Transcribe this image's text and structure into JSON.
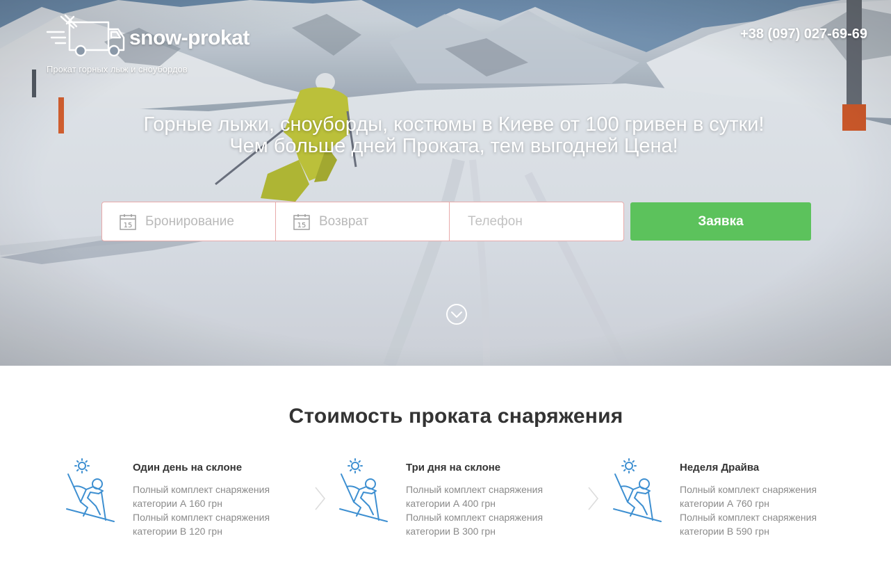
{
  "brand": {
    "name": "snow-prokat",
    "tagline": "Прокат горных лыж и сноубордов"
  },
  "header": {
    "phone": "+38 (097) 027-69-69"
  },
  "hero": {
    "headline_line1": "Горные лыжи, сноуборды, костюмы в Киеве от 100 гривен в сутки!",
    "headline_line2": "Чем больше дней Проката, тем выгодней Цена!"
  },
  "booking_form": {
    "booking_date": {
      "placeholder": "Бронирование",
      "value": "",
      "icon": "calendar-icon",
      "calendar_day": "15"
    },
    "return_date": {
      "placeholder": "Возврат",
      "value": "",
      "icon": "calendar-icon",
      "calendar_day": "15"
    },
    "phone": {
      "placeholder": "Телефон",
      "value": ""
    },
    "submit_label": "Заявка"
  },
  "pricing": {
    "title": "Стоимость проката снаряжения",
    "plans": [
      {
        "icon": "skier-icon",
        "title": "Один день на склоне",
        "lines": [
          "Полный комплект снаряжения",
          "категории А 160 грн",
          "Полный комплект снаряжения",
          "категории В 120 грн"
        ]
      },
      {
        "icon": "skier-icon",
        "title": "Три дня на склоне",
        "lines": [
          "Полный комплект снаряжения",
          "категории А 400 грн",
          "Полный комплект снаряжения",
          "категории В 300 грн"
        ]
      },
      {
        "icon": "skier-icon",
        "title": "Неделя Драйва",
        "lines": [
          "Полный комплект снаряжения",
          "категории А 760 грн",
          "Полный комплект снаряжения",
          "категории В 590 грн"
        ]
      }
    ]
  },
  "colors": {
    "accent_green": "#5cc25c",
    "icon_blue": "#3d8fd1",
    "text_dark": "#333333",
    "text_muted": "#8a8a8a",
    "input_border": "#e8aaaa"
  }
}
